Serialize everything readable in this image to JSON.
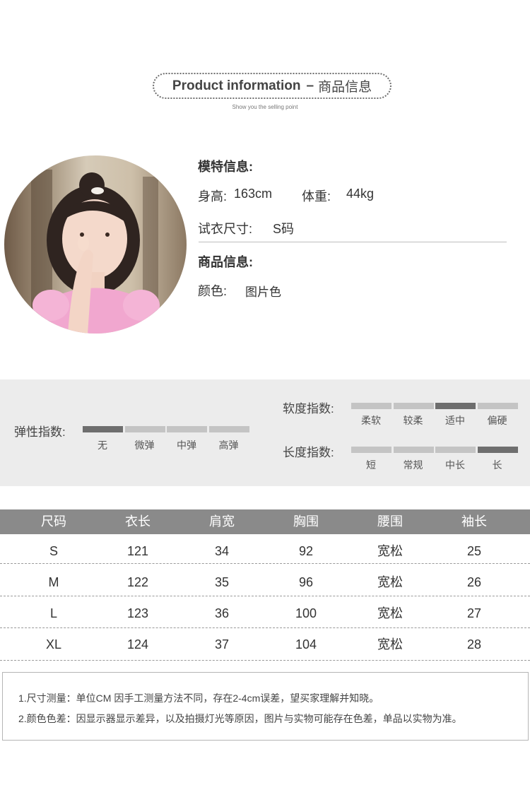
{
  "header": {
    "title_en": "Product information",
    "title_dash": "–",
    "title_cn": "商品信息",
    "subtitle": "Show you the selling point"
  },
  "model": {
    "section_title": "模特信息:",
    "height_label": "身高:",
    "height_value": "163cm",
    "weight_label": "体重:",
    "weight_value": "44kg",
    "size_label": "试衣尺寸:",
    "size_value": "S码"
  },
  "product": {
    "section_title": "商品信息:",
    "color_label": "颜色:",
    "color_value": "图片色"
  },
  "indices": {
    "elasticity": {
      "label": "弹性指数:",
      "options": [
        "无",
        "微弹",
        "中弹",
        "高弹"
      ],
      "selected": "无"
    },
    "softness": {
      "label": "软度指数:",
      "options": [
        "柔软",
        "较柔",
        "适中",
        "偏硬"
      ],
      "selected": "适中"
    },
    "length": {
      "label": "长度指数:",
      "options": [
        "短",
        "常规",
        "中长",
        "长"
      ],
      "selected": "长"
    }
  },
  "size_table": {
    "headers": [
      "尺码",
      "衣长",
      "肩宽",
      "胸围",
      "腰围",
      "袖长"
    ],
    "rows": [
      [
        "S",
        "121",
        "34",
        "92",
        "宽松",
        "25"
      ],
      [
        "M",
        "122",
        "35",
        "96",
        "宽松",
        "26"
      ],
      [
        "L",
        "123",
        "36",
        "100",
        "宽松",
        "27"
      ],
      [
        "XL",
        "124",
        "37",
        "104",
        "宽松",
        "28"
      ]
    ]
  },
  "notes": [
    "1.尺寸测量：单位CM 因手工测量方法不同，存在2-4cm误差，望买家理解并知晓。",
    "2.颜色色差：因显示器显示差异，以及拍摄灯光等原因，图片与实物可能存在色差，单品以实物为准。"
  ],
  "colors": {
    "band_bg": "#ececec",
    "bar_active": "#6e6e6e",
    "bar_inactive": "#c4c4c4",
    "table_header": "#8a8a8a",
    "dress_pink": "#f1a7cf"
  }
}
